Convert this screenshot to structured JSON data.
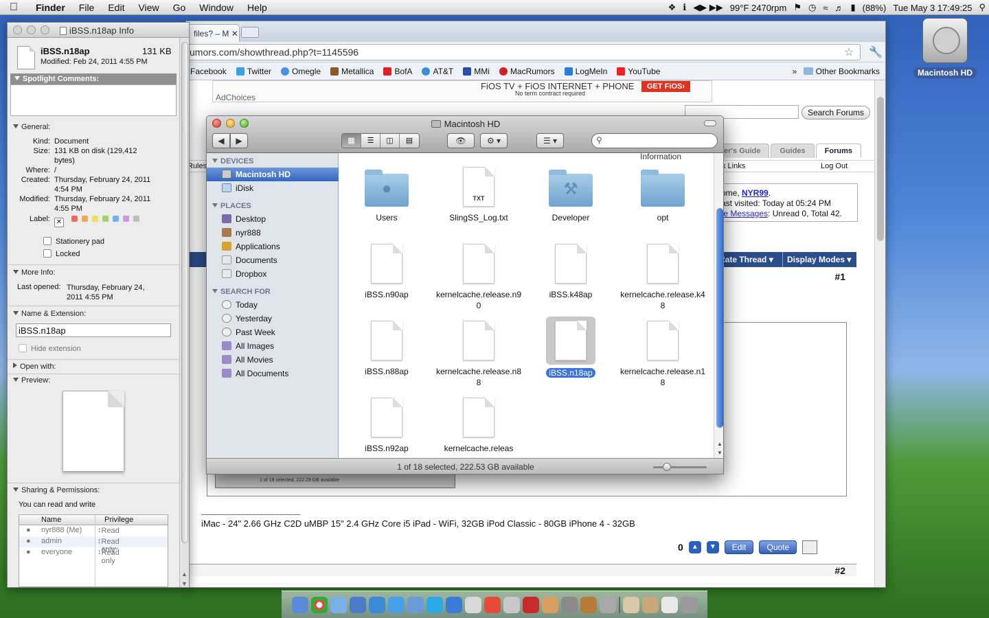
{
  "menubar": {
    "app": "Finder",
    "menus": [
      "File",
      "Edit",
      "View",
      "Go",
      "Window",
      "Help"
    ],
    "status": {
      "weather": "99°F 2470rpm",
      "battery": "(88%)",
      "datetime": "Tue May 3  17:49:25"
    }
  },
  "desktop": {
    "hd_label": "Macintosh HD"
  },
  "browser": {
    "tab_label": "files? – M",
    "url": "umors.com/showthread.php?t=1145596",
    "bookmarks": [
      "Facebook",
      "Twitter",
      "Omegle",
      "Metallica",
      "BofA",
      "AT&T",
      "MMi",
      "MacRumors",
      "LogMeIn",
      "YouTube"
    ],
    "other_bookmarks": "Other Bookmarks",
    "ad": {
      "headline": "FiOS TV + FiOS INTERNET + PHONE",
      "small": "No term contract required",
      "cta": "GET FiOS›",
      "adchoices": "AdChoices"
    },
    "search_forums": "Search Forums",
    "forum_tabs": [
      "er's Guide",
      "Guides",
      "Forums"
    ],
    "nav": {
      "rules": "Rules",
      "links": "k Links",
      "logout": "Log Out",
      "information": "Information"
    },
    "welcome": {
      "line1_prefix": "ome, ",
      "user": "NYR99",
      "line2": "ast visited: Today at 05:24 PM",
      "line3_link": "te Messages",
      "line3_rest": ": Unread 0, Total 42."
    },
    "thread_bar": {
      "rate": "Rate Thread",
      "display": "Display Modes"
    },
    "post1": "#1",
    "post2": "#2",
    "inner_status": "1 of 18 selected, 222.29 GB available",
    "signature": " iMac - 24\" 2.66 GHz C2D   uMBP 15\" 2.4 GHz Core i5   iPad - WiFi, 32GB   iPod Classic - 80GB   iPhone 4 - 32GB ",
    "actions": {
      "count": "0",
      "edit": "Edit",
      "quote": "Quote"
    }
  },
  "info_window": {
    "title": "iBSS.n18ap Info",
    "file_name": "iBSS.n18ap",
    "file_size": "131 KB",
    "modified": "Modified: Feb 24, 2011 4:55 PM",
    "spotlight_header": "Spotlight Comments:",
    "general_header": "General:",
    "kind_label": "Kind:",
    "kind": "Document",
    "size_label": "Size:",
    "size": "131 KB on disk (129,412 bytes)",
    "where_label": "Where:",
    "where": "/",
    "created_label": "Created:",
    "created": "Thursday, February 24, 2011 4:54 PM",
    "modified_label": "Modified:",
    "modified_full": "Thursday, February 24, 2011 4:55 PM",
    "label_label": "Label:",
    "stationery": "Stationery pad",
    "locked": "Locked",
    "more_info_header": "More Info:",
    "last_opened_label": "Last opened:",
    "last_opened": "Thursday, February 24, 2011 4:55 PM",
    "name_ext_header": "Name & Extension:",
    "name_field": "iBSS.n18ap",
    "hide_ext": "Hide extension",
    "open_with_header": "Open with:",
    "preview_header": "Preview:",
    "sharing_header": "Sharing & Permissions:",
    "sharing_text": "You can read and write",
    "perm_headers": [
      "Name",
      "Privilege"
    ],
    "perms": [
      {
        "name": "nyr888 (Me)",
        "priv": "Read & Write"
      },
      {
        "name": "admin",
        "priv": "Read only"
      },
      {
        "name": "everyone",
        "priv": "Read only"
      }
    ],
    "label_colors": [
      "#f06a5e",
      "#f5a851",
      "#f2dc5d",
      "#9fd36c",
      "#6fb0f2",
      "#c49be2",
      "#bdbdbd"
    ]
  },
  "finder": {
    "title": "Macintosh HD",
    "devices_header": "DEVICES",
    "places_header": "PLACES",
    "search_header": "SEARCH FOR",
    "devices": [
      "Macintosh HD",
      "iDisk"
    ],
    "places": [
      "Desktop",
      "nyr888",
      "Applications",
      "Documents",
      "Dropbox"
    ],
    "searches": [
      "Today",
      "Yesterday",
      "Past Week",
      "All Images",
      "All Movies",
      "All Documents"
    ],
    "items": [
      {
        "name": "Users",
        "kind": "folder"
      },
      {
        "name": "SlingSS_Log.txt",
        "kind": "txt",
        "ext": "TXT"
      },
      {
        "name": "Developer",
        "kind": "folder"
      },
      {
        "name": "opt",
        "kind": "folder"
      },
      {
        "name": "iBSS.n90ap",
        "kind": "doc"
      },
      {
        "name": "kernelcache.release.n90",
        "kind": "doc"
      },
      {
        "name": "iBSS.k48ap",
        "kind": "doc"
      },
      {
        "name": "kernelcache.release.k48",
        "kind": "doc"
      },
      {
        "name": "iBSS.n88ap",
        "kind": "doc"
      },
      {
        "name": "kernelcache.release.n88",
        "kind": "doc"
      },
      {
        "name": "iBSS.n18ap",
        "kind": "doc",
        "selected": true
      },
      {
        "name": "kernelcache.release.n18",
        "kind": "doc"
      },
      {
        "name": "iBSS.n92ap",
        "kind": "doc"
      },
      {
        "name": "kernelcache.releas",
        "kind": "doc"
      }
    ],
    "status": "1 of 18 selected, 222.53 GB available"
  }
}
